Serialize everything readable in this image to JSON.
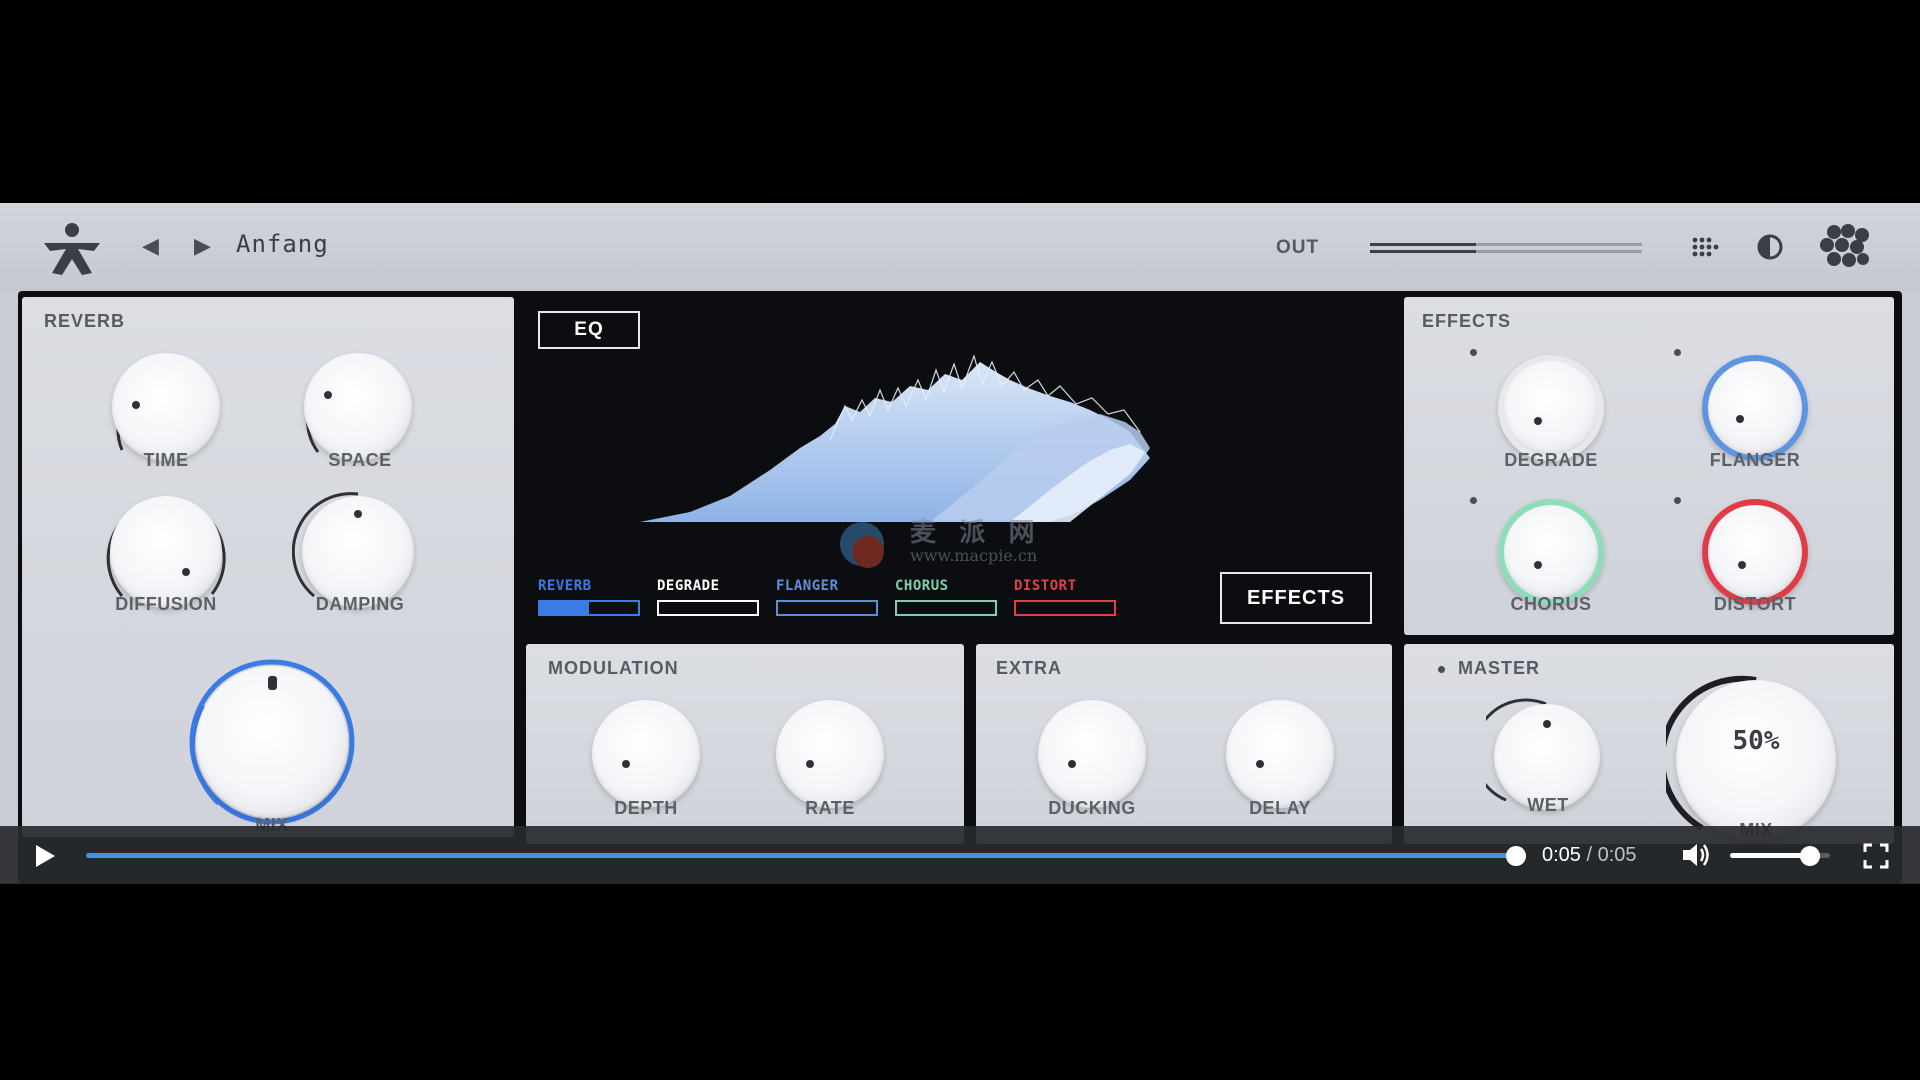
{
  "topbar": {
    "preset_name": "Anfang",
    "prev_icon": "triangle-left-icon",
    "next_icon": "triangle-right-icon",
    "out_label": "OUT",
    "out_level": 0.39,
    "icons": [
      "grid-dots-icon",
      "contrast-icon",
      "flower-logo-icon"
    ]
  },
  "reverb": {
    "title": "REVERB",
    "knobs": [
      "TIME",
      "SPACE",
      "DIFFUSION",
      "DAMPING"
    ],
    "mix_label": "MIX"
  },
  "center": {
    "eq_label": "EQ",
    "effects_label": "EFFECTS",
    "tabs": [
      {
        "label": "REVERB",
        "color": "#3b7be6",
        "fill": 0.5
      },
      {
        "label": "DEGRADE",
        "color": "#ffffff",
        "fill": 0
      },
      {
        "label": "FLANGER",
        "color": "#5f8fd6",
        "fill": 0
      },
      {
        "label": "CHORUS",
        "color": "#7fcfa8",
        "fill": 0
      },
      {
        "label": "DISTORT",
        "color": "#e0404a",
        "fill": 0
      }
    ],
    "watermark": "麦 派 网",
    "watermark_url": "www.macpie.cn"
  },
  "effects": {
    "title": "EFFECTS",
    "knobs": [
      {
        "label": "DEGRADE",
        "ring": "#d6d8de"
      },
      {
        "label": "FLANGER",
        "ring": "#5f95e0"
      },
      {
        "label": "CHORUS",
        "ring": "#8fdcb9"
      },
      {
        "label": "DISTORT",
        "ring": "#e03c47"
      }
    ]
  },
  "modulation": {
    "title": "MODULATION",
    "knobs": [
      "DEPTH",
      "RATE"
    ]
  },
  "extra": {
    "title": "EXTRA",
    "knobs": [
      "DUCKING",
      "DELAY"
    ]
  },
  "master": {
    "title": "MASTER",
    "wet_label": "WET",
    "mix_value": "50%",
    "mix_label": "MIX"
  },
  "player": {
    "current_time": "0:05",
    "separator": " / ",
    "duration": "0:05",
    "progress": 1.0,
    "volume": 0.8,
    "accent": "#4a90e2"
  }
}
